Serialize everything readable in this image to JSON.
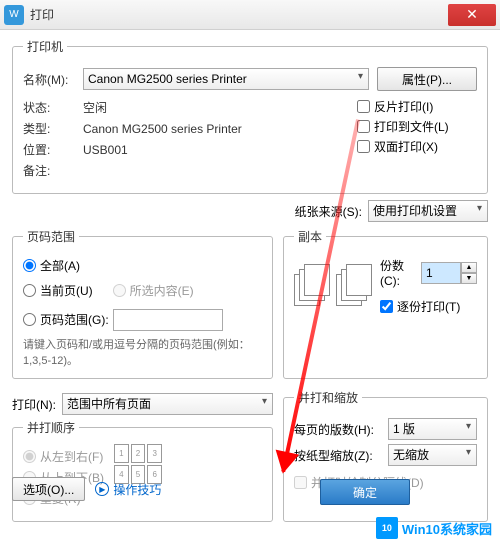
{
  "title": "打印",
  "printer": {
    "legend": "打印机",
    "name_label": "名称(M):",
    "name": "Canon MG2500 series Printer",
    "props_btn": "属性(P)...",
    "status_label": "状态:",
    "status": "空闲",
    "type_label": "类型:",
    "type": "Canon MG2500 series Printer",
    "where_label": "位置:",
    "where": "USB001",
    "comment_label": "备注:",
    "reverse": "反片打印(I)",
    "tofile": "打印到文件(L)",
    "duplex": "双面打印(X)"
  },
  "paper_src_label": "纸张来源(S):",
  "paper_src": "使用打印机设置",
  "range": {
    "legend": "页码范围",
    "all": "全部(A)",
    "current": "当前页(U)",
    "selection": "所选内容(E)",
    "pages": "页码范围(G):",
    "pages_val": "",
    "note": "请键入页码和/或用逗号分隔的页码范围(例如：1,3,5-12)。"
  },
  "copies": {
    "legend": "副本",
    "count_label": "份数(C):",
    "count": "1",
    "collate": "逐份打印(T)"
  },
  "print_what_label": "打印(N):",
  "print_what": "范围中所有页面",
  "scale": {
    "legend": "并打和缩放",
    "per_page_label": "每页的版数(H):",
    "per_page": "1 版",
    "scale_label": "按纸型缩放(Z):",
    "scale": "无缩放",
    "drawlines": "并打时绘制分隔线(D)"
  },
  "order": {
    "legend": "并打顺序",
    "lr": "从左到右(F)",
    "tb": "从上到下(B)",
    "repeat": "重复(R)"
  },
  "options_btn": "选项(O)...",
  "tips": "操作技巧",
  "ok": "确定",
  "watermark": "Win10系统家园"
}
